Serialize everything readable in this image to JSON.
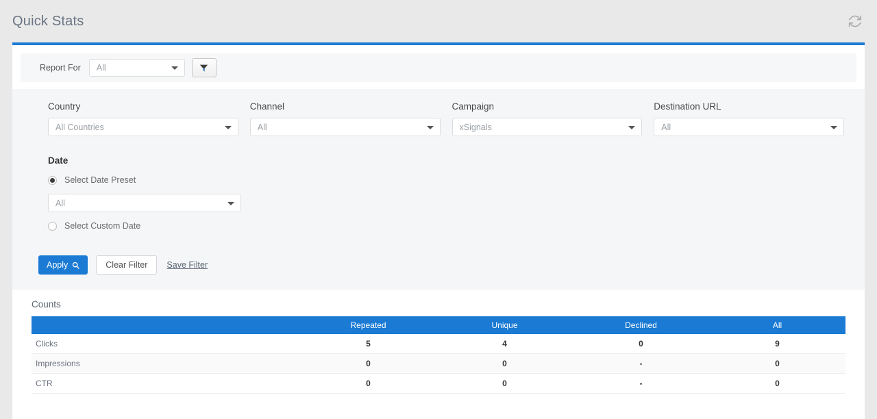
{
  "header": {
    "title": "Quick Stats",
    "refresh_icon": "refresh-icon"
  },
  "report_for": {
    "label": "Report For",
    "value": "All",
    "filter_icon": "filter-funnel-icon"
  },
  "filters": {
    "fields": [
      {
        "label": "Country",
        "value": "All Countries"
      },
      {
        "label": "Channel",
        "value": "All"
      },
      {
        "label": "Campaign",
        "value": "xSignals"
      },
      {
        "label": "Destination URL",
        "value": "All"
      }
    ],
    "date": {
      "label": "Date",
      "preset_radio_label": "Select Date Preset",
      "preset_value": "All",
      "custom_radio_label": "Select Custom Date",
      "selected": "preset"
    },
    "actions": {
      "apply_label": "Apply",
      "apply_icon": "magnifier-icon",
      "clear_label": "Clear Filter",
      "save_label": "Save Filter"
    }
  },
  "counts": {
    "title": "Counts",
    "columns": [
      "",
      "Repeated",
      "Unique",
      "Declined",
      "All"
    ],
    "rows": [
      {
        "label": "Clicks",
        "repeated": "5",
        "unique": "4",
        "declined": "0",
        "all": "9"
      },
      {
        "label": "Impressions",
        "repeated": "0",
        "unique": "0",
        "declined": "-",
        "all": "0"
      },
      {
        "label": "CTR",
        "repeated": "0",
        "unique": "0",
        "declined": "-",
        "all": "0"
      }
    ]
  },
  "colors": {
    "accent": "#1a7ad4",
    "page_bg": "#e9e9e9",
    "panel_bg": "#f5f6f8"
  }
}
